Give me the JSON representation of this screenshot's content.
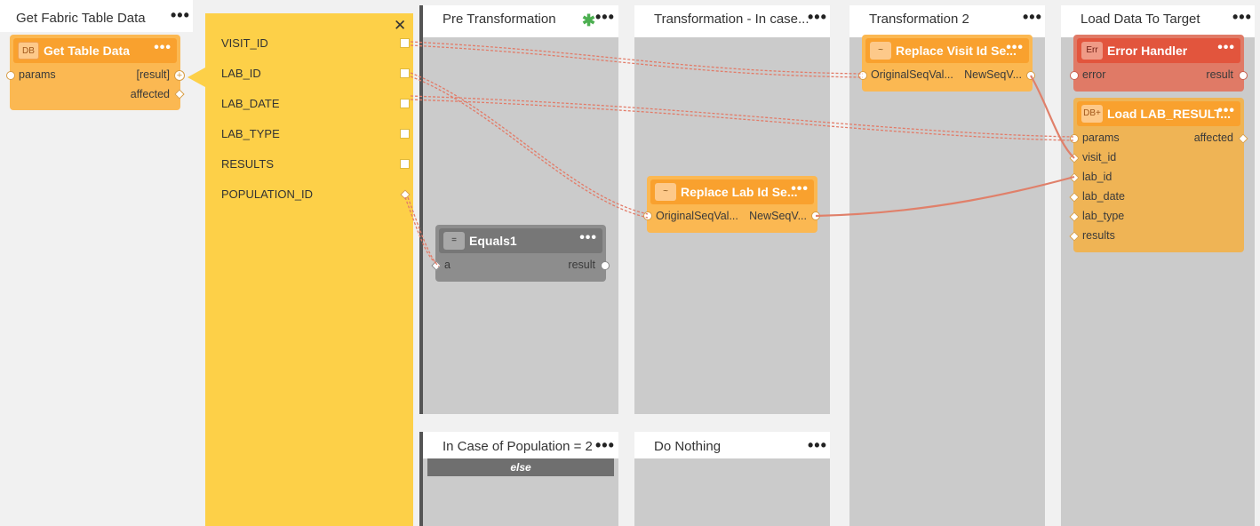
{
  "columns": [
    {
      "title": "Get Fabric Table Data"
    },
    {
      "title": "Pre Transformation"
    },
    {
      "title": "Transformation - In case..."
    },
    {
      "title": "Transformation 2"
    },
    {
      "title": "Load Data To Target"
    },
    {
      "title": "In Case of Population = 2"
    },
    {
      "title": "Do Nothing"
    }
  ],
  "else_label": "else",
  "close_glyph": "✕",
  "fields": [
    "VISIT_ID",
    "LAB_ID",
    "LAB_DATE",
    "LAB_TYPE",
    "RESULTS",
    "POPULATION_ID"
  ],
  "nodes": {
    "get_table_data": {
      "badge": "DB",
      "title": "Get Table Data",
      "in_ports": [
        "params"
      ],
      "out_ports": [
        "[result]",
        "affected"
      ]
    },
    "equals1": {
      "badge": "=",
      "title": "Equals1",
      "in_ports": [
        "a"
      ],
      "out_ports": [
        "result"
      ]
    },
    "replace_lab": {
      "badge": "~",
      "title": "Replace Lab Id Se...",
      "in_ports": [
        "OriginalSeqVal..."
      ],
      "out_ports": [
        "NewSeqV..."
      ]
    },
    "replace_visit": {
      "badge": "~",
      "title": "Replace Visit Id Se...",
      "in_ports": [
        "OriginalSeqVal..."
      ],
      "out_ports": [
        "NewSeqV..."
      ]
    },
    "error_handler": {
      "badge": "Err",
      "title": "Error Handler",
      "in_ports": [
        "error"
      ],
      "out_ports": [
        "result"
      ]
    },
    "load_lab": {
      "badge": "DB+",
      "title": "Load LAB_RESULT...",
      "in_ports": [
        "params",
        "visit_id",
        "lab_id",
        "lab_date",
        "lab_type",
        "results"
      ],
      "out_ports": [
        "affected"
      ]
    }
  },
  "colors": {
    "orange_node": "#fbb852",
    "orange_head": "#f9a12e",
    "load_node": "#efb455",
    "yellow_list": "#fdd048",
    "gray_node": "#8d8d8d",
    "gray_head": "#777777",
    "error_node": "#e07a66",
    "error_head": "#e2553d",
    "wire_solid": "#e0806a",
    "wire_dashed": "#e27b68",
    "star": "#4caf50"
  }
}
